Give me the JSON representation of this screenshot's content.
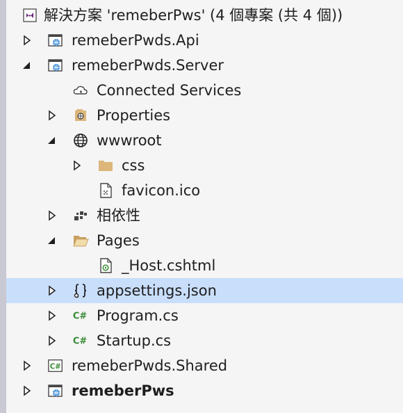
{
  "solution_explorer": {
    "rows": [
      {
        "label": "解決方案 'remeberPws' (4 個專案 (共 4 個))",
        "icon": "visual-studio-solution-icon",
        "expander": "none",
        "depth": 0
      },
      {
        "label": "remeberPwds.Api",
        "icon": "web-project-icon",
        "expander": "collapsed",
        "depth": 0
      },
      {
        "label": "remeberPwds.Server",
        "icon": "web-project-icon",
        "expander": "expanded",
        "depth": 0
      },
      {
        "label": "Connected Services",
        "icon": "connected-services-icon",
        "expander": "none",
        "depth": 1
      },
      {
        "label": "Properties",
        "icon": "properties-icon",
        "expander": "collapsed",
        "depth": 1
      },
      {
        "label": "wwwroot",
        "icon": "globe-icon",
        "expander": "expanded",
        "depth": 1
      },
      {
        "label": "css",
        "icon": "folder-icon",
        "expander": "collapsed",
        "depth": 2
      },
      {
        "label": "favicon.ico",
        "icon": "image-file-icon",
        "expander": "none",
        "depth": 2
      },
      {
        "label": "相依性",
        "icon": "dependencies-icon",
        "expander": "collapsed",
        "depth": 1
      },
      {
        "label": "Pages",
        "icon": "folder-open-icon",
        "expander": "expanded",
        "depth": 1
      },
      {
        "label": "_Host.cshtml",
        "icon": "razor-file-icon",
        "expander": "none",
        "depth": 2
      },
      {
        "label": "appsettings.json",
        "icon": "json-file-icon",
        "expander": "collapsed",
        "depth": 1,
        "selected": true
      },
      {
        "label": "Program.cs",
        "icon": "csharp-file-icon",
        "expander": "collapsed",
        "depth": 1
      },
      {
        "label": "Startup.cs",
        "icon": "csharp-file-icon",
        "expander": "collapsed",
        "depth": 1
      },
      {
        "label": "remeberPwds.Shared",
        "icon": "csharp-project-icon",
        "expander": "collapsed",
        "depth": 0
      },
      {
        "label": "remeberPws",
        "icon": "web-project-icon",
        "expander": "collapsed",
        "depth": 0,
        "bold": true
      }
    ]
  },
  "colors": {
    "selection": "#c9defb",
    "csharp_green": "#388a34",
    "vs_purple": "#68217a",
    "folder": "#dcb67a",
    "project_blue": "#1e7bd4"
  }
}
